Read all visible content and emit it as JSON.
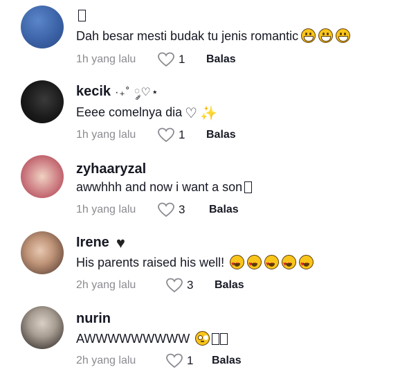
{
  "comments": [
    {
      "username": "",
      "username_deco": "",
      "text": "Dah besar mesti budak tu jenis romantic",
      "time": "1h yang lalu",
      "likes": "1",
      "reply_label": "Balas",
      "emoji": [
        "grinning-face",
        "grinning-face",
        "grinning-face"
      ]
    },
    {
      "username": "kecik",
      "username_deco": "·₊˚ ༘♡⋆",
      "text": "Eeee comelnya dia",
      "time": "1h yang lalu",
      "likes": "1",
      "reply_label": "Balas",
      "emoji": [
        "white-heart",
        "sparkles"
      ]
    },
    {
      "username": "zyhaaryzal",
      "username_deco": "",
      "text": "awwhhh and now i want a son",
      "time": "1h yang lalu",
      "likes": "3",
      "reply_label": "Balas",
      "emoji": []
    },
    {
      "username": "Irene",
      "username_deco": "",
      "text": "His parents raised his well!",
      "time": "2h yang lalu",
      "likes": "3",
      "reply_label": "Balas",
      "emoji": [
        "heart-eyes",
        "heart-eyes",
        "heart-eyes",
        "heart-eyes",
        "heart-eyes"
      ]
    },
    {
      "username": "nurin",
      "username_deco": "",
      "text": "AWWWWWWWWW",
      "time": "2h yang lalu",
      "likes": "1",
      "reply_label": "Balas",
      "emoji": [
        "pleading-face"
      ]
    }
  ],
  "colors": {
    "text_primary": "#161823",
    "text_secondary": "#8a8b91",
    "emoji_yellow": "#f9c51a"
  }
}
